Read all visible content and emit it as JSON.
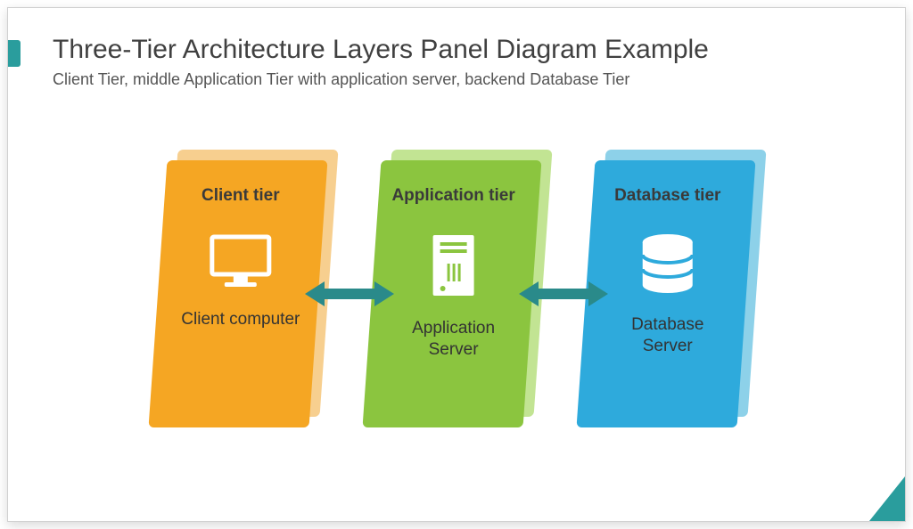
{
  "title": "Three-Tier Architecture Layers Panel Diagram Example",
  "subtitle": "Client Tier, middle Application Tier with application server, backend Database Tier",
  "tiers": {
    "client": {
      "title": "Client tier",
      "label": "Client computer",
      "icon": "monitor",
      "color": "#f5a623"
    },
    "application": {
      "title": "Application tier",
      "label": "Application Server",
      "icon": "server-tower",
      "color": "#8bc53f"
    },
    "database": {
      "title": "Database tier",
      "label": "Database Server",
      "icon": "database-cylinder",
      "color": "#2eaadc"
    }
  },
  "arrow_color": "#2a8a8a"
}
